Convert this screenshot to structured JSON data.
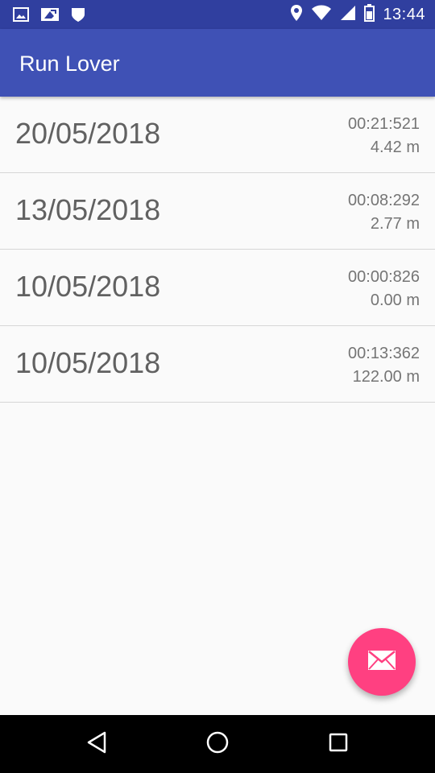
{
  "status_bar": {
    "time": "13:44",
    "icons_left": [
      "image-icon",
      "photo-edit-icon",
      "shield-icon"
    ],
    "icons_right": [
      "location-icon",
      "wifi-icon",
      "signal-icon",
      "battery-icon"
    ],
    "background": "#303f9f"
  },
  "app_bar": {
    "title": "Run Lover",
    "background": "#3f51b5"
  },
  "runs": [
    {
      "date": "20/05/2018",
      "time": "00:21:521",
      "distance": "4.42 m"
    },
    {
      "date": "13/05/2018",
      "time": "00:08:292",
      "distance": "2.77 m"
    },
    {
      "date": "10/05/2018",
      "time": "00:00:826",
      "distance": "0.00 m"
    },
    {
      "date": "10/05/2018",
      "time": "00:13:362",
      "distance": "122.00 m"
    }
  ],
  "fab": {
    "icon": "email-icon",
    "color": "#ff4081"
  },
  "nav_bar": {
    "buttons": [
      "back-icon",
      "home-icon",
      "recents-icon"
    ]
  }
}
